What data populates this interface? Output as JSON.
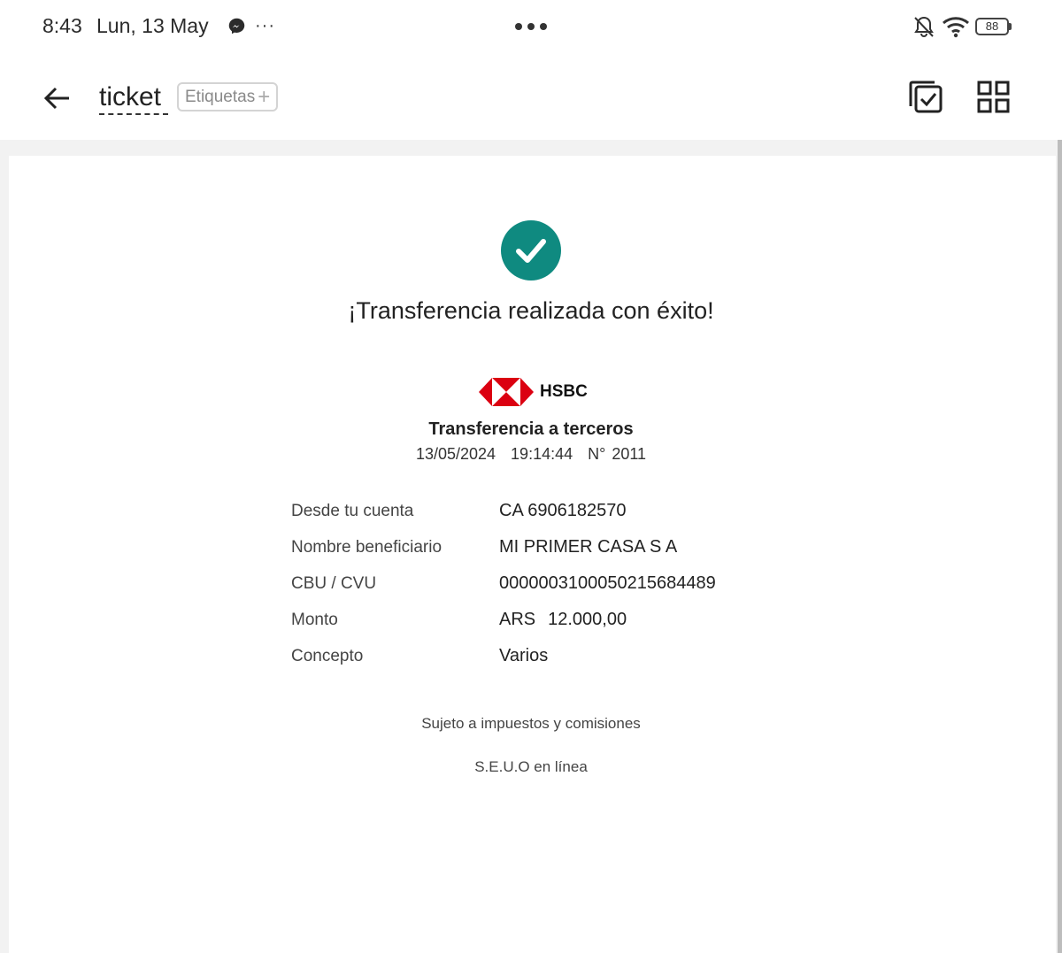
{
  "status_bar": {
    "time": "8:43",
    "date": "Lun, 13 May",
    "more": "···",
    "battery": "88"
  },
  "app_bar": {
    "title": "ticket",
    "tags_label": "Etiquetas",
    "tags_add": "+"
  },
  "receipt": {
    "success_message": "¡Transferencia realizada con éxito!",
    "bank_name": "HSBC",
    "transfer_type": "Transferencia a terceros",
    "date": "13/05/2024",
    "time": "19:14:44",
    "number": "N° 2011",
    "details": [
      {
        "label": "Desde tu cuenta",
        "value": "CA 6906182570"
      },
      {
        "label": "Nombre beneficiario",
        "value": "MI PRIMER CASA S A"
      },
      {
        "label": "CBU / CVU",
        "value": "0000003100050215684489"
      },
      {
        "label": "Monto",
        "currency": "ARS",
        "value": "12.000,00"
      },
      {
        "label": "Concepto",
        "value": "Varios"
      }
    ],
    "footnote_taxes": "Sujeto a impuestos y comisiones",
    "footnote_seuo": "S.E.U.O en línea"
  },
  "colors": {
    "success_teal": "#0f8a80",
    "hsbc_red": "#db0011",
    "background": "#ffffff",
    "doc_area_bg": "#f2f2f2"
  },
  "icons": [
    "messenger-icon",
    "center-dots-icon",
    "mute-icon",
    "wifi-icon",
    "back-arrow-icon",
    "plus-icon",
    "check-docs-icon",
    "grid-view-icon",
    "success-check-icon",
    "hsbc-logo"
  ]
}
